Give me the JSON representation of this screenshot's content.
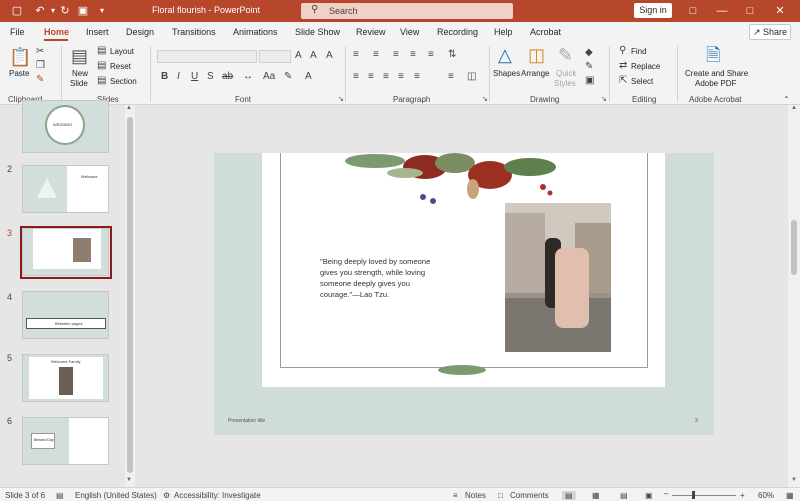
{
  "window": {
    "doc_title": "Floral flourish  -  PowerPoint",
    "search_placeholder": "Search",
    "sign_in": "Sign in"
  },
  "tabs": [
    "File",
    "Home",
    "Insert",
    "Design",
    "Transitions",
    "Animations",
    "Slide Show",
    "Review",
    "View",
    "Recording",
    "Help",
    "Acrobat"
  ],
  "share": "Share",
  "ribbon": {
    "clipboard": {
      "label": "Clipboard",
      "paste": "Paste"
    },
    "slides": {
      "label": "Slides",
      "new_slide_1": "New",
      "new_slide_2": "Slide",
      "layout": "Layout",
      "reset": "Reset",
      "section": "Section"
    },
    "font": {
      "label": "Font"
    },
    "paragraph": {
      "label": "Paragraph"
    },
    "drawing": {
      "label": "Drawing",
      "shapes": "Shapes",
      "arrange": "Arrange",
      "quick_1": "Quick",
      "quick_2": "Styles"
    },
    "editing": {
      "label": "Editing",
      "find": "Find",
      "replace": "Replace",
      "select": "Select"
    },
    "acrobat": {
      "label": "Adobe Acrobat",
      "create_1": "Create and Share",
      "create_2": "Adobe PDF"
    }
  },
  "thumbnails": [
    {
      "num": "2",
      "text": "Welcome"
    },
    {
      "num": "3",
      "text": ""
    },
    {
      "num": "4",
      "text": "Between pages"
    },
    {
      "num": "5",
      "text": "Welcome Family"
    },
    {
      "num": "6",
      "text": "Blessed Day"
    }
  ],
  "thumb_top_text": "WEDDING",
  "slide": {
    "quote": "\"Being deeply loved by someone gives you strength, while loving someone deeply gives you courage.\"—Lao Tzu.",
    "footer_left": "Presentation title",
    "footer_right": "3"
  },
  "status": {
    "slide": "Slide 3 of 6",
    "language": "English (United States)",
    "accessibility": "Accessibility: Investigate",
    "notes": "Notes",
    "comments": "Comments",
    "zoom": "60%"
  },
  "colors": {
    "accent": "#b7472a",
    "slide_bg": "#cfdcd9"
  }
}
